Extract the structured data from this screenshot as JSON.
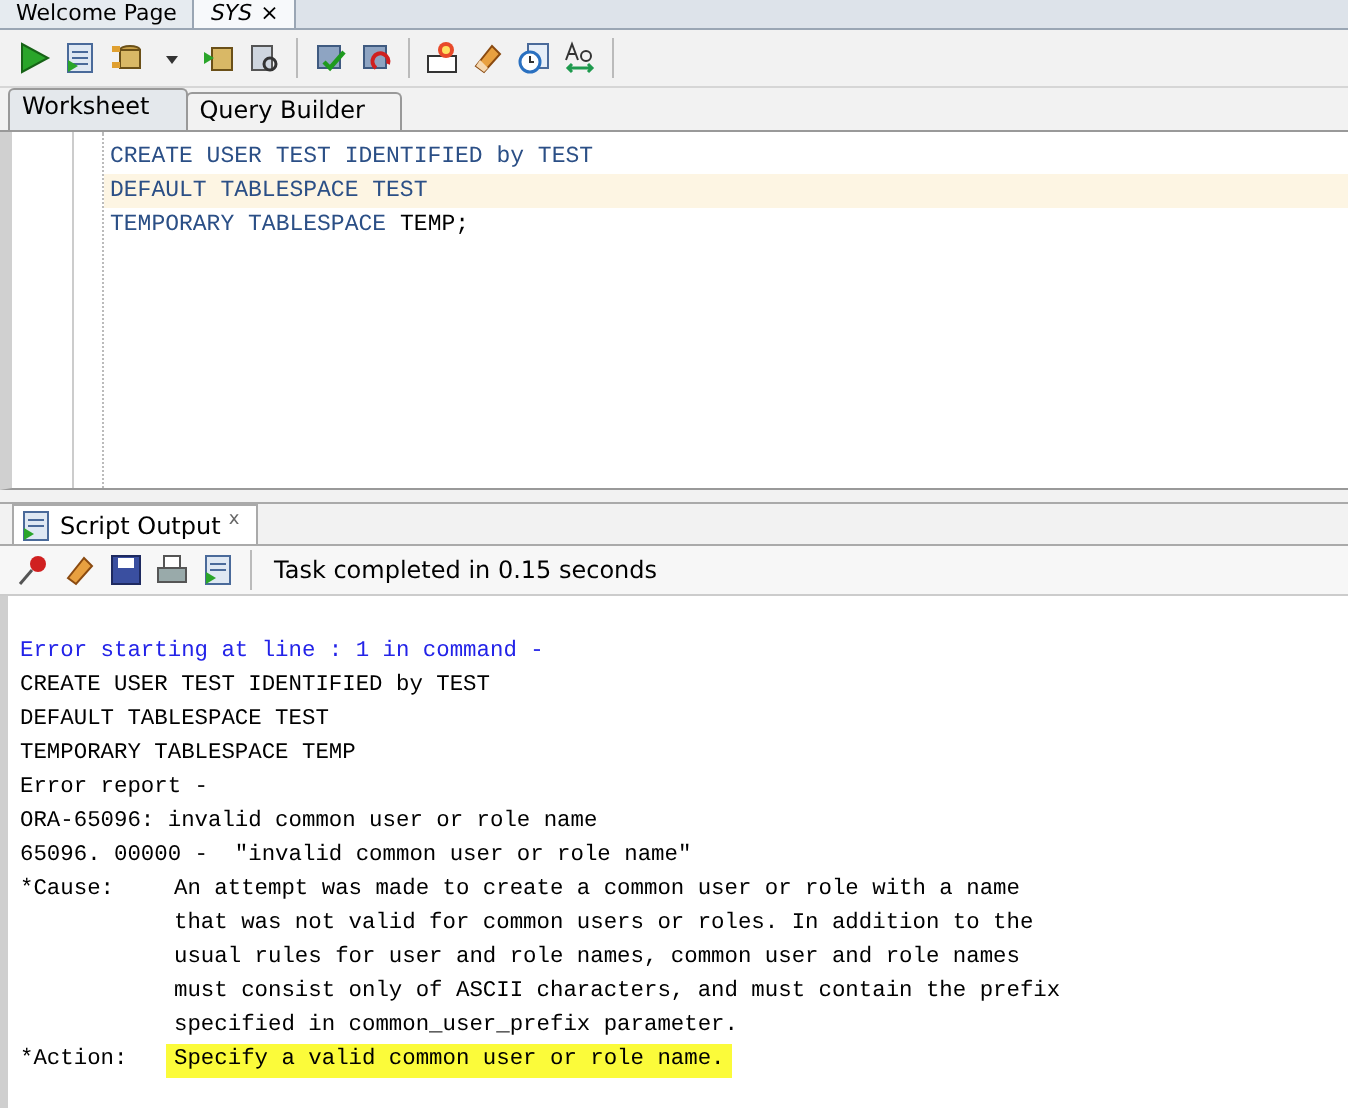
{
  "document_tabs": [
    {
      "label": "Welcome Page",
      "selected": false
    },
    {
      "label": "SYS",
      "selected": true,
      "close": "×"
    }
  ],
  "worksheet_tabs": [
    {
      "label": "Worksheet",
      "selected": true
    },
    {
      "label": "Query Builder",
      "selected": false
    }
  ],
  "editor": {
    "lines": [
      {
        "current": false,
        "tokens": [
          {
            "kind": "keyword",
            "text": "CREATE USER TEST IDENTIFIED by TEST"
          }
        ]
      },
      {
        "current": true,
        "tokens": [
          {
            "kind": "keyword",
            "text": "DEFAULT TABLESPACE TEST"
          }
        ]
      },
      {
        "current": false,
        "tokens": [
          {
            "kind": "keyword",
            "text": "TEMPORARY TABLESPACE"
          },
          {
            "kind": "identifier",
            "text": "TEMP;"
          }
        ]
      }
    ]
  },
  "output_panel": {
    "tab": {
      "label": "Script Output",
      "close": "x"
    },
    "status": "Task completed in 0.15 seconds",
    "lines": [
      {
        "kind": "note",
        "text": "Error starting at line : 1 in command -"
      },
      {
        "kind": "plain",
        "text": "CREATE USER TEST IDENTIFIED by TEST"
      },
      {
        "kind": "plain",
        "text": "DEFAULT TABLESPACE TEST"
      },
      {
        "kind": "plain",
        "text": "TEMPORARY TABLESPACE TEMP"
      },
      {
        "kind": "plain",
        "text": "Error report -"
      },
      {
        "kind": "plain",
        "text": "ORA-65096: invalid common user or role name"
      },
      {
        "kind": "plain",
        "text": "65096. 00000 -  \"invalid common user or role name\""
      },
      {
        "kind": "field",
        "label": "*Cause:",
        "text": "An attempt was made to create a common user or role with a name",
        "highlighted": false
      },
      {
        "kind": "field",
        "text": "that was not valid for common users or roles. In addition to the",
        "highlighted": false
      },
      {
        "kind": "field",
        "text": "usual rules for user and role names, common user and role names",
        "highlighted": false
      },
      {
        "kind": "field",
        "text": "must consist only of ASCII characters, and must contain the prefix",
        "highlighted": false
      },
      {
        "kind": "field",
        "text": "specified in common_user_prefix parameter.",
        "highlighted": false
      },
      {
        "kind": "field",
        "label": "*Action:",
        "text": "Specify a valid common user or role name.",
        "highlighted": true
      }
    ]
  }
}
